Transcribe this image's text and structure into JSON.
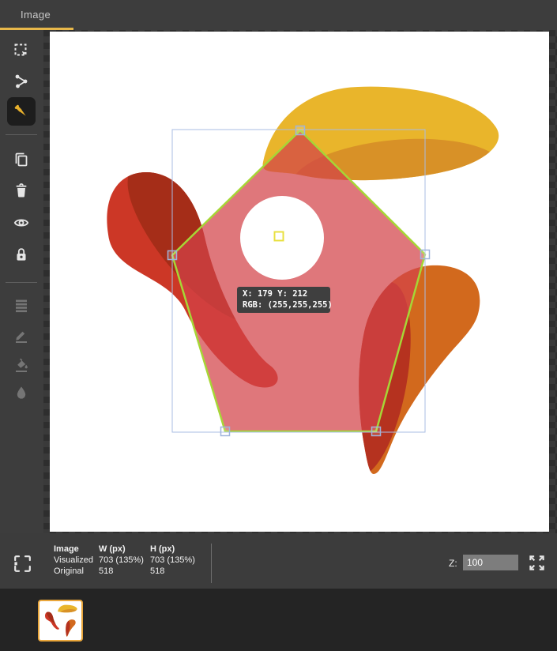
{
  "header": {
    "tab_label": "Image",
    "accent_color": "#e8b84a"
  },
  "toolbar": {
    "tools": [
      {
        "name": "marquee-select",
        "state": "enabled"
      },
      {
        "name": "share",
        "state": "enabled"
      },
      {
        "name": "color-picker",
        "state": "active"
      },
      {
        "name": "duplicate",
        "state": "enabled"
      },
      {
        "name": "delete",
        "state": "enabled"
      },
      {
        "name": "visibility",
        "state": "enabled"
      },
      {
        "name": "lock",
        "state": "enabled"
      },
      {
        "name": "layers",
        "state": "disabled"
      },
      {
        "name": "draw",
        "state": "disabled"
      },
      {
        "name": "fill",
        "state": "disabled"
      },
      {
        "name": "blur",
        "state": "disabled"
      }
    ]
  },
  "canvas": {
    "tooltip": {
      "position_line": "X: 179 Y: 212",
      "rgb_line": "RGB: (255,255,255)"
    },
    "selection": {
      "shape": "pentagon",
      "outline_color": "#a6d636",
      "box_color": "#a9bce3",
      "center_handle_color": "#e8e040"
    },
    "image_colors": {
      "petal_yellow": "#e9b52b",
      "petal_yellow_shade": "#d89127",
      "petal_red": "#cc3726",
      "petal_red_shade": "#a52d18",
      "petal_orange": "#d2691d",
      "petal_orange_shade": "#b5321f",
      "pentagon_fill": "#d24248",
      "circle_fill": "#ffffff"
    }
  },
  "status_bar": {
    "size_table": {
      "headers": [
        "Image",
        "W (px)",
        "H (px)"
      ],
      "rows": [
        {
          "label": "Visualized",
          "w": "703 (135%)",
          "h": "703 (135%)"
        },
        {
          "label": "Original",
          "w": "518",
          "h": "518"
        }
      ]
    },
    "zoom_label": "Z:",
    "zoom_value": "100"
  }
}
